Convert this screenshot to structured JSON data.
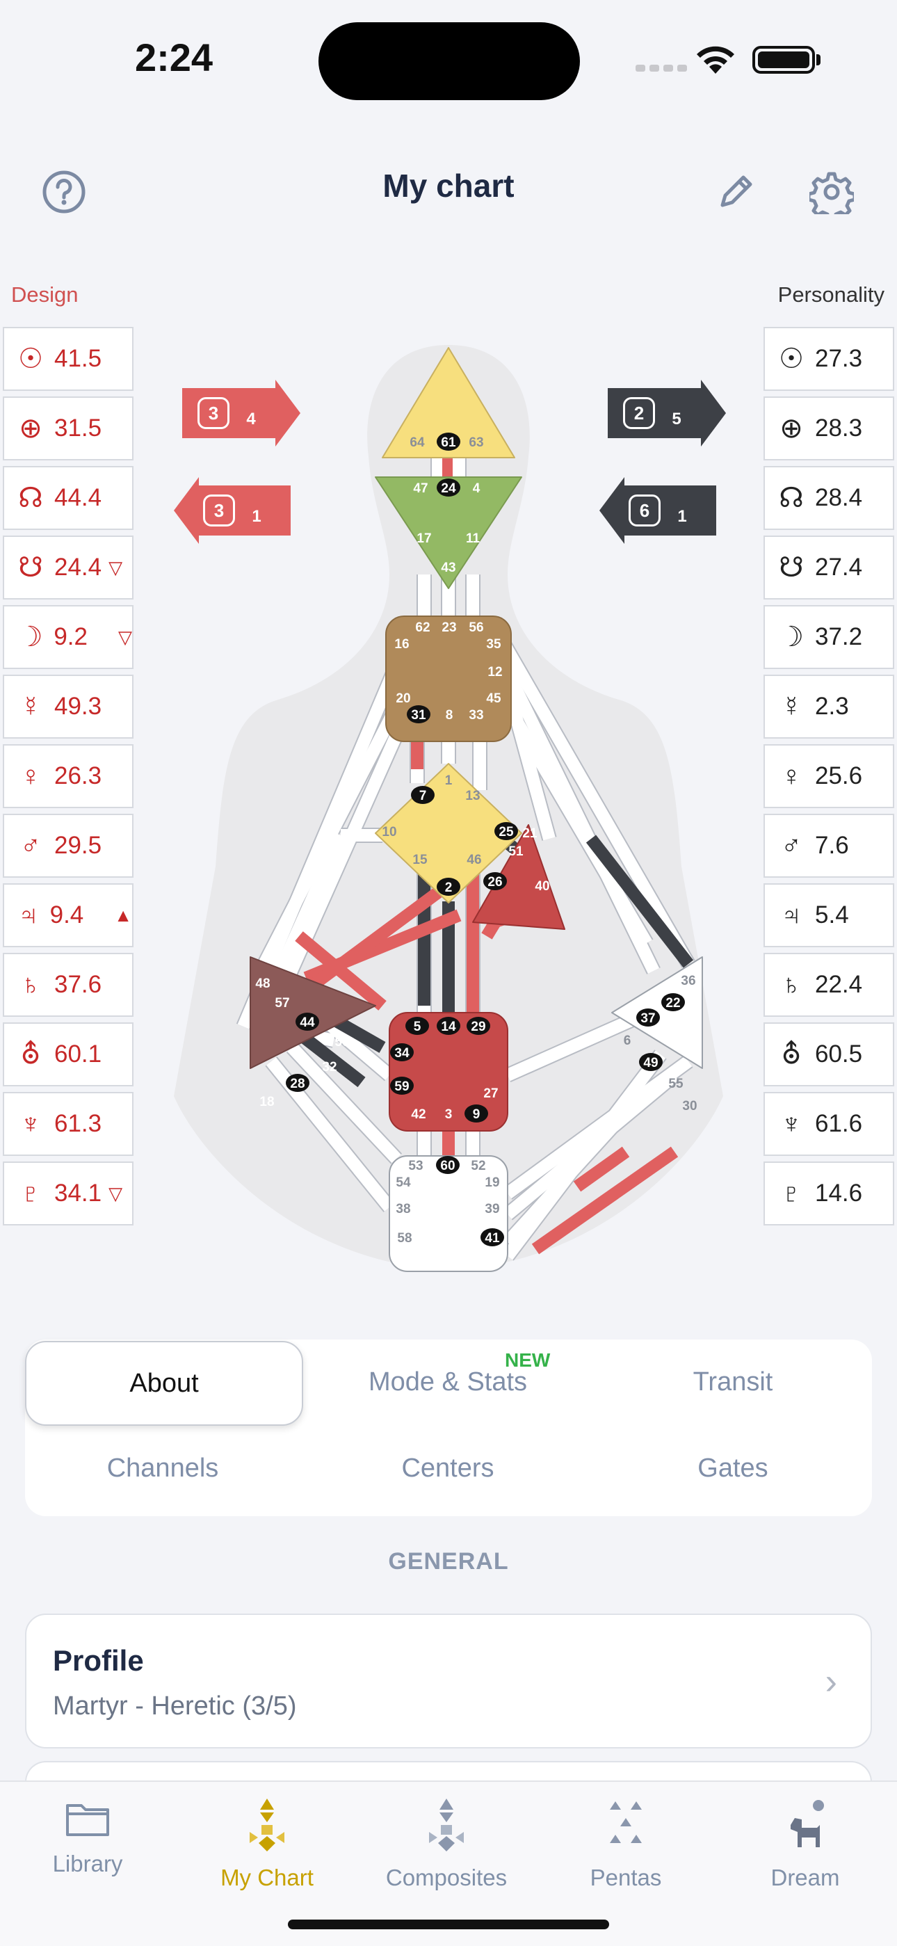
{
  "status": {
    "time": "2:24"
  },
  "header": {
    "title": "My chart"
  },
  "labels": {
    "design": "Design",
    "personality": "Personality"
  },
  "design": [
    {
      "glyph": "☉",
      "value": "41.5",
      "mark": ""
    },
    {
      "glyph": "⊕",
      "value": "31.5",
      "mark": ""
    },
    {
      "glyph": "☊",
      "value": "44.4",
      "mark": ""
    },
    {
      "glyph": "☋",
      "value": "24.4",
      "mark": "▽"
    },
    {
      "glyph": "☽",
      "value": "9.2",
      "mark": "▽"
    },
    {
      "glyph": "☿",
      "value": "49.3",
      "mark": ""
    },
    {
      "glyph": "♀",
      "value": "26.3",
      "mark": ""
    },
    {
      "glyph": "♂",
      "value": "29.5",
      "mark": ""
    },
    {
      "glyph": "♃",
      "value": "9.4",
      "mark": "▲"
    },
    {
      "glyph": "♄",
      "value": "37.6",
      "mark": ""
    },
    {
      "glyph": "⛢",
      "value": "60.1",
      "mark": ""
    },
    {
      "glyph": "♆",
      "value": "61.3",
      "mark": ""
    },
    {
      "glyph": "♇",
      "value": "34.1",
      "mark": "▽"
    }
  ],
  "personality": [
    {
      "glyph": "☉",
      "value": "27.3"
    },
    {
      "glyph": "⊕",
      "value": "28.3"
    },
    {
      "glyph": "☊",
      "value": "28.4"
    },
    {
      "glyph": "☋",
      "value": "27.4"
    },
    {
      "glyph": "☽",
      "value": "37.2"
    },
    {
      "glyph": "☿",
      "value": "2.3"
    },
    {
      "glyph": "♀",
      "value": "25.6"
    },
    {
      "glyph": "♂",
      "value": "7.6"
    },
    {
      "glyph": "♃",
      "value": "5.4"
    },
    {
      "glyph": "♄",
      "value": "22.4"
    },
    {
      "glyph": "⛢",
      "value": "60.5"
    },
    {
      "glyph": "♆",
      "value": "61.6"
    },
    {
      "glyph": "♇",
      "value": "14.6"
    }
  ],
  "arrows": {
    "design_top": {
      "a": "3",
      "b": "4"
    },
    "design_bottom": {
      "a": "3",
      "b": "1"
    },
    "pers_top": {
      "a": "2",
      "b": "5"
    },
    "pers_bottom": {
      "a": "6",
      "b": "1"
    }
  },
  "colors": {
    "design_red": "#e06060",
    "personality_dark": "#3d4046",
    "accent_gold": "#c7a100"
  },
  "bodygraph": {
    "head": {
      "gates": [
        "64",
        "61",
        "63"
      ]
    },
    "ajna": {
      "gates": [
        "47",
        "24",
        "4",
        "17",
        "11",
        "43"
      ]
    },
    "throat": {
      "gates": [
        "62",
        "23",
        "56",
        "16",
        "35",
        "12",
        "20",
        "45",
        "31",
        "8",
        "33"
      ]
    },
    "g": {
      "gates": [
        "1",
        "13",
        "10",
        "25",
        "15",
        "46",
        "7",
        "2"
      ]
    },
    "heart": {
      "gates": [
        "21",
        "51",
        "26",
        "40"
      ]
    },
    "spleen": {
      "gates": [
        "48",
        "57",
        "44",
        "50",
        "32",
        "28",
        "18"
      ]
    },
    "sacral": {
      "gates": [
        "5",
        "14",
        "29",
        "34",
        "27",
        "59",
        "42",
        "3",
        "9"
      ]
    },
    "solar": {
      "gates": [
        "36",
        "22",
        "37",
        "6",
        "49",
        "55",
        "30"
      ]
    },
    "root": {
      "gates": [
        "53",
        "60",
        "52",
        "54",
        "19",
        "38",
        "39",
        "58",
        "41"
      ]
    }
  },
  "tabs": {
    "about": "About",
    "mode": "Mode & Stats",
    "new": "NEW",
    "transit": "Transit",
    "channels": "Channels",
    "centers": "Centers",
    "gates": "Gates"
  },
  "general": "GENERAL",
  "profile": {
    "title": "Profile",
    "subtitle": "Martyr - Heretic (3/5)"
  },
  "tabbar": {
    "library": "Library",
    "mychart": "My Chart",
    "composites": "Composites",
    "pentas": "Pentas",
    "dream": "Dream"
  }
}
